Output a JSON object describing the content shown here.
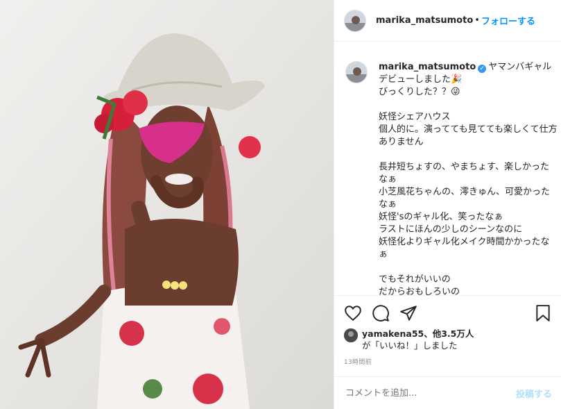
{
  "post": {
    "username": "marika_matsumoto",
    "dot": "•",
    "follow_label": "フォローする",
    "caption": "ヤマンバギャルデビューしました🎉\nびっくりした？？😜\n\n妖怪シェアハウス\n個人的に。演ってても見てても楽しくて仕方ありません\n\n長井短ちょすの、やまちょす、楽しかったなぁ\n小芝風花ちゃんの、澪きゅん、可愛かったなぁ\n妖怪'sのギャル化、笑ったなぁ\nラストにほんの少しのシーンなのに\n妖怪化よりギャル化メイク時間かかったなぁ\n\nでもそれがいいの\nだからおもしろいの",
    "verified_symbol": "✓"
  },
  "likes": {
    "liker": "yamakena55",
    "count_text": "、他3.5万人",
    "suffix": "が「いいね！」しました"
  },
  "time_ago": "13時間前",
  "comment": {
    "placeholder": "コメントを追加...",
    "post_label": "投稿する"
  },
  "icons": [
    "heart-icon",
    "comment-icon",
    "share-icon",
    "bookmark-icon"
  ]
}
